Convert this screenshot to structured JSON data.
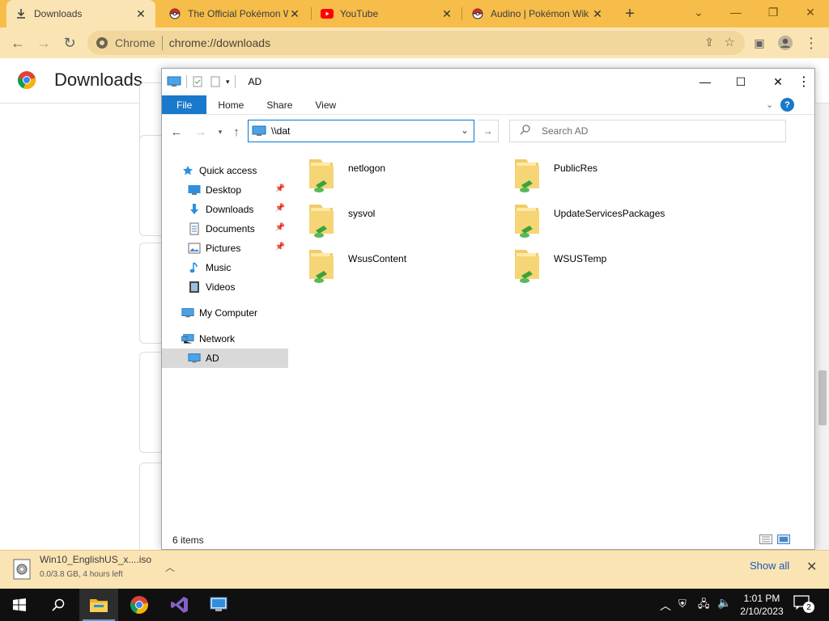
{
  "browser": {
    "tabs": [
      {
        "label": "Downloads",
        "icon": "download-icon"
      },
      {
        "label": "The Official Pokémon W",
        "icon": "pokeball-icon"
      },
      {
        "label": "YouTube",
        "icon": "youtube-icon"
      },
      {
        "label": "Audino | Pokémon Wik",
        "icon": "pokeball-icon"
      }
    ],
    "new_tab_label": "+",
    "omnibox": {
      "site_chip": "Chrome",
      "url": "chrome://downloads"
    }
  },
  "downloads_page": {
    "title": "Downloads"
  },
  "explorer": {
    "title": "AD",
    "ribbon_tabs": [
      "File",
      "Home",
      "Share",
      "View"
    ],
    "address_value": "\\\\dat",
    "search_placeholder": "Search AD",
    "nav": [
      {
        "label": "Quick access",
        "icon": "star-icon"
      },
      {
        "label": "Desktop",
        "icon": "desktop-icon",
        "pinned": true
      },
      {
        "label": "Downloads",
        "icon": "download-arrow-icon",
        "pinned": true
      },
      {
        "label": "Documents",
        "icon": "document-icon",
        "pinned": true
      },
      {
        "label": "Pictures",
        "icon": "pictures-icon",
        "pinned": true
      },
      {
        "label": "Music",
        "icon": "music-icon"
      },
      {
        "label": "Videos",
        "icon": "video-icon"
      },
      {
        "label": "My Computer",
        "icon": "computer-icon"
      },
      {
        "label": "Network",
        "icon": "network-icon"
      },
      {
        "label": "AD",
        "icon": "computer-icon",
        "selected": true
      }
    ],
    "items": [
      "netlogon",
      "PublicRes",
      "sysvol",
      "UpdateServicesPackages",
      "WsusContent",
      "WSUSTemp"
    ],
    "status": "6 items"
  },
  "shelf": {
    "file_name": "Win10_EnglishUS_x....iso",
    "file_status": "0.0/3.8 GB, 4 hours left",
    "show_all": "Show all"
  },
  "taskbar": {
    "time": "1:01 PM",
    "date": "2/10/2023",
    "notifications": "2"
  },
  "colors": {
    "tab_strip": "#f6bd4a",
    "toolbar": "#fbe4b3",
    "accent": "#1979ca"
  }
}
